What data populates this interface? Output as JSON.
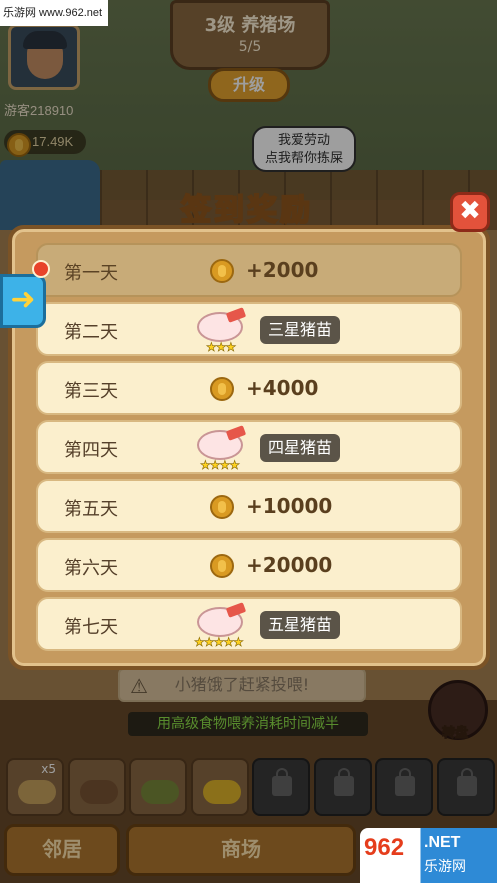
{
  "watermark": "乐游网 www.962.net",
  "player": {
    "name": "游客218910",
    "coins": "17.49K"
  },
  "farm": {
    "title": "3级 养猪场",
    "level": "5/5",
    "upgrade_label": "升级"
  },
  "speech_bubble": {
    "line1": "我爱劳动",
    "line2": "点我帮你拣屎"
  },
  "modal": {
    "title": "签到奖励",
    "close_icon": "close-x",
    "side_arrow_icon": "arrow-right",
    "days": [
      {
        "label": "第一天",
        "reward_type": "coin",
        "reward": "+2000",
        "claimed": true
      },
      {
        "label": "第二天",
        "reward_type": "pig",
        "reward": "三星猪苗",
        "stars": 3
      },
      {
        "label": "第三天",
        "reward_type": "coin",
        "reward": "+4000"
      },
      {
        "label": "第四天",
        "reward_type": "pig",
        "reward": "四星猪苗",
        "stars": 4
      },
      {
        "label": "第五天",
        "reward_type": "coin",
        "reward": "+10000"
      },
      {
        "label": "第六天",
        "reward_type": "coin",
        "reward": "+20000"
      },
      {
        "label": "第七天",
        "reward_type": "pig",
        "reward": "五星猪苗",
        "stars": 5
      }
    ]
  },
  "hint": "小猪饿了赶紧投喂!",
  "feed_tip": "用高级食物喂养消耗时间减半",
  "turntable_label": "转盘",
  "food_slots": [
    {
      "icon": "grain-feed",
      "count": "x5",
      "color": "#c9a35e"
    },
    {
      "icon": "nut-feed",
      "count": "",
      "color": "#7a5434"
    },
    {
      "icon": "bean-feed",
      "count": "",
      "color": "#7a8a3a"
    },
    {
      "icon": "corn-feed",
      "count": "",
      "color": "#e0b52a"
    },
    {
      "icon": "lock-icon",
      "locked": true
    },
    {
      "icon": "lock-icon",
      "locked": true
    },
    {
      "icon": "lock-icon",
      "locked": true
    },
    {
      "icon": "lock-icon",
      "locked": true
    }
  ],
  "bottom_nav": {
    "neighbors": "邻居",
    "shop": "商场"
  },
  "site_badge": {
    "number": "962",
    "domain": ".NET",
    "name": "乐游网"
  }
}
